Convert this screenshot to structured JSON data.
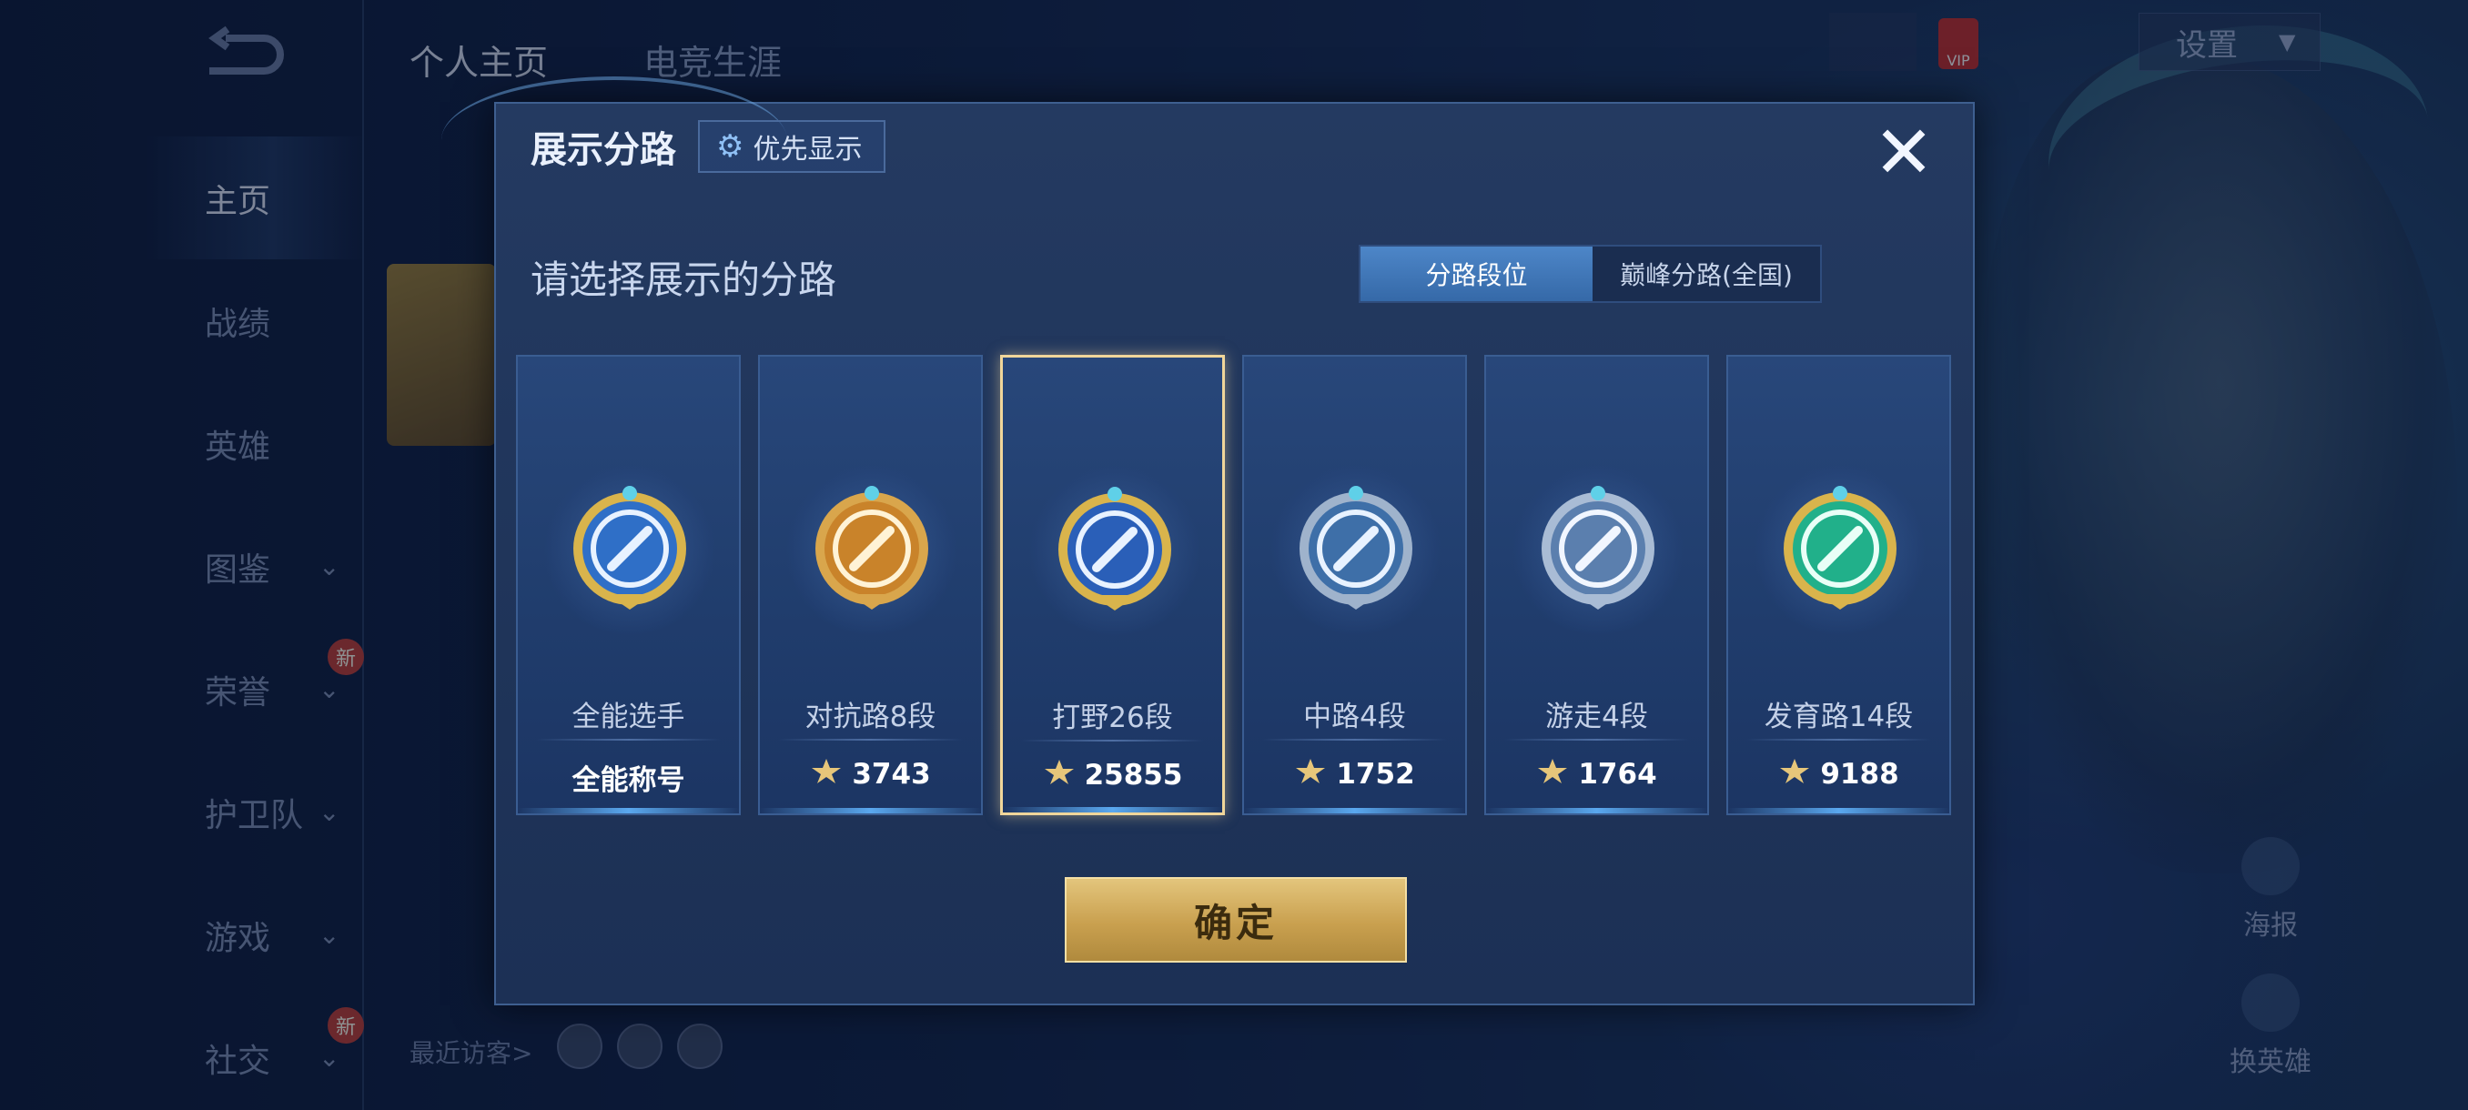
{
  "background": {
    "back_icon": "back-arrow-icon",
    "top_tabs": [
      "个人主页",
      "电竞生涯"
    ],
    "sidenav": [
      {
        "label": "主页",
        "active": true,
        "has_chevron": false,
        "is_new": false
      },
      {
        "label": "战绩",
        "has_chevron": false,
        "is_new": false
      },
      {
        "label": "英雄",
        "has_chevron": false,
        "is_new": false
      },
      {
        "label": "图鉴",
        "has_chevron": true,
        "is_new": false
      },
      {
        "label": "荣誉",
        "has_chevron": true,
        "is_new": true
      },
      {
        "label": "护卫队",
        "has_chevron": true,
        "is_new": false
      },
      {
        "label": "游戏",
        "has_chevron": true,
        "is_new": false
      },
      {
        "label": "社交",
        "has_chevron": true,
        "is_new": true
      }
    ],
    "new_badge": "新",
    "recent_visitors_label": "最近访客>",
    "settings_label": "设置",
    "vip_label": "VIP",
    "right_buttons": [
      "海报",
      "换英雄"
    ]
  },
  "modal": {
    "title": "展示分路",
    "priority_button": "优先显示",
    "close_icon": "close-icon",
    "subtitle": "请选择展示的分路",
    "segments": [
      {
        "label": "分路段位",
        "active": true
      },
      {
        "label": "巅峰分路(全国)",
        "active": false
      }
    ],
    "cards": [
      {
        "name": "全能选手",
        "score": "全能称号",
        "has_icon": false,
        "emblem": "all-round",
        "selected": false
      },
      {
        "name": "对抗路8段",
        "score": "3743",
        "has_icon": true,
        "emblem": "clash-lane",
        "selected": false
      },
      {
        "name": "打野26段",
        "score": "25855",
        "has_icon": true,
        "emblem": "jungle",
        "selected": true
      },
      {
        "name": "中路4段",
        "score": "1752",
        "has_icon": true,
        "emblem": "mid-lane",
        "selected": false
      },
      {
        "name": "游走4段",
        "score": "1764",
        "has_icon": true,
        "emblem": "roam",
        "selected": false
      },
      {
        "name": "发育路14段",
        "score": "9188",
        "has_icon": true,
        "emblem": "farm-lane",
        "selected": false
      }
    ],
    "confirm_label": "确定",
    "colors": {
      "gold": "#d4b06a",
      "selected_border": "#f0d69a",
      "accent_blue": "#4d86c8"
    }
  }
}
